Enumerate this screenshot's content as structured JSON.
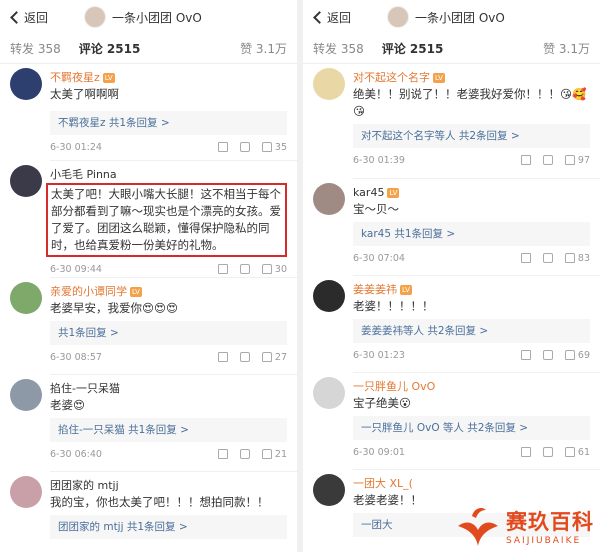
{
  "nav": {
    "back_label": "返回",
    "title": "一条小团团 OvO"
  },
  "tabs": {
    "repost": "转发 358",
    "comments": "评论 2515",
    "likes": "赞 3.1万"
  },
  "left_comments": [
    {
      "user": "不羁夜星z",
      "vip": "",
      "text": "太美了啊啊啊",
      "reply": "不羁夜星z 共1条回复 >",
      "time": "6-30 01:24",
      "likes": "35",
      "avatar": "#2d3f6e"
    },
    {
      "user": "小毛毛 Pinna",
      "vip": "",
      "text": "太美了吧！大眼小嘴大长腿！这不相当于每个部分都看到了嘛～现实也是个漂亮的女孩。爱了爱了。团团这么聪颖，懂得保护隐私的同时，也给真爱粉一份美好的礼物。",
      "reply": "",
      "time": "6-30 09:44",
      "likes": "30",
      "avatar": "#3b3a48"
    },
    {
      "user": "亲爱的小谭同学",
      "vip": "",
      "text": "老婆早安，我爱你😍😍😍",
      "reply": "共1条回复 >",
      "time": "6-30 08:57",
      "likes": "27",
      "avatar": "#7fa96a"
    },
    {
      "user": "掐住-一只呆猫",
      "vip": "",
      "text": "老婆😍",
      "reply": "掐住-一只呆猫 共1条回复 >",
      "time": "6-30 06:40",
      "likes": "21",
      "avatar": "#8e99a8"
    },
    {
      "user": "团团家的 mtjj",
      "vip": "",
      "text": "我的宝，你也太美了吧！！！想拍同款！！",
      "reply": "团团家的 mtjj 共1条回复 >",
      "time": "",
      "likes": "",
      "avatar": "#c9a0a8"
    }
  ],
  "right_comments": [
    {
      "user": "对不起这个名字",
      "vip": "",
      "text": "绝美！！别说了！！老婆我好爱你！！！😘🥰😘",
      "reply": "对不起这个名字等人 共2条回复 >",
      "time": "6-30 01:39",
      "likes": "97",
      "avatar": "#e9d8a6"
    },
    {
      "user": "kar45",
      "vip": "",
      "text": "宝～贝～",
      "reply": "kar45 共1条回复 >",
      "time": "6-30 07:04",
      "likes": "83",
      "avatar": "#a08b84"
    },
    {
      "user": "姜姜姜祎",
      "vip": "",
      "text": "老婆！！！！！",
      "reply": "姜姜姜祎等人 共2条回复 >",
      "time": "6-30 01:23",
      "likes": "69",
      "avatar": "#2b2b2b"
    },
    {
      "user": "一只胖鱼儿 OvO",
      "vip": "",
      "text": "宝子绝美😮",
      "reply": "一只胖鱼儿 OvO 等人 共2条回复 >",
      "time": "6-30 09:01",
      "likes": "61",
      "avatar": "#d6d6d6"
    },
    {
      "user": "一团大 XL_(",
      "vip": "",
      "text": "老婆老婆！！",
      "reply": "一团大",
      "time": "",
      "likes": "",
      "avatar": "#3a3a3a"
    }
  ],
  "watermark": {
    "cn": "赛玖百科",
    "py": "SAIJIUBAIKE"
  }
}
